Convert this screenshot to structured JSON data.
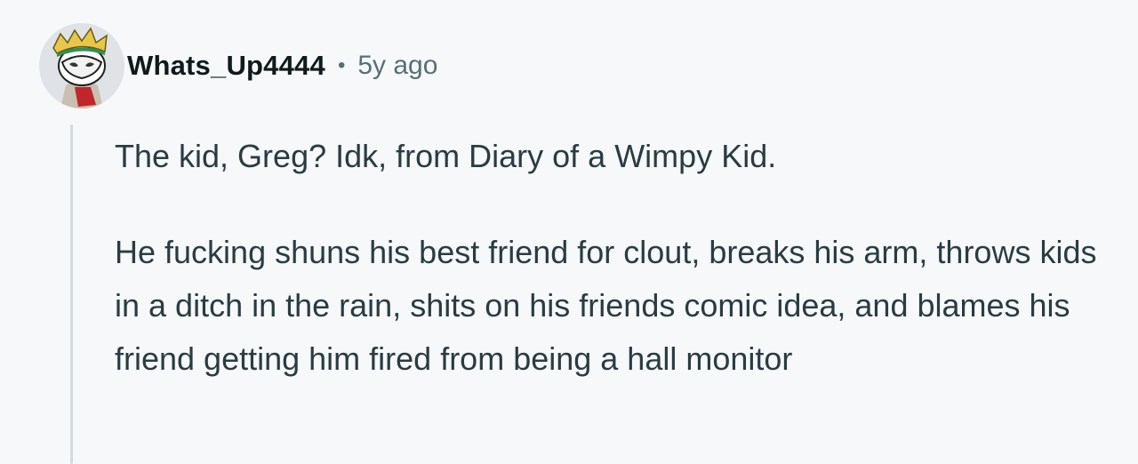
{
  "comment": {
    "author": "Whats_Up4444",
    "separator": "•",
    "time_ago": "5y ago",
    "paragraphs": [
      "The kid, Greg? Idk, from Diary of a Wimpy Kid.",
      "He fucking shuns his best friend for clout, breaks his arm, throws kids in a ditch in the rain, shits on his friends comic idea, and blames his friend getting him fired from being a hall monitor"
    ]
  },
  "colors": {
    "background": "#f7f8fa",
    "author_text": "#0f1a1c",
    "meta_text": "#576f76",
    "body_text": "#2a3c42",
    "thread_line": "#d3dae0"
  },
  "icons": {
    "avatar": "snoo-avatar-icon"
  }
}
